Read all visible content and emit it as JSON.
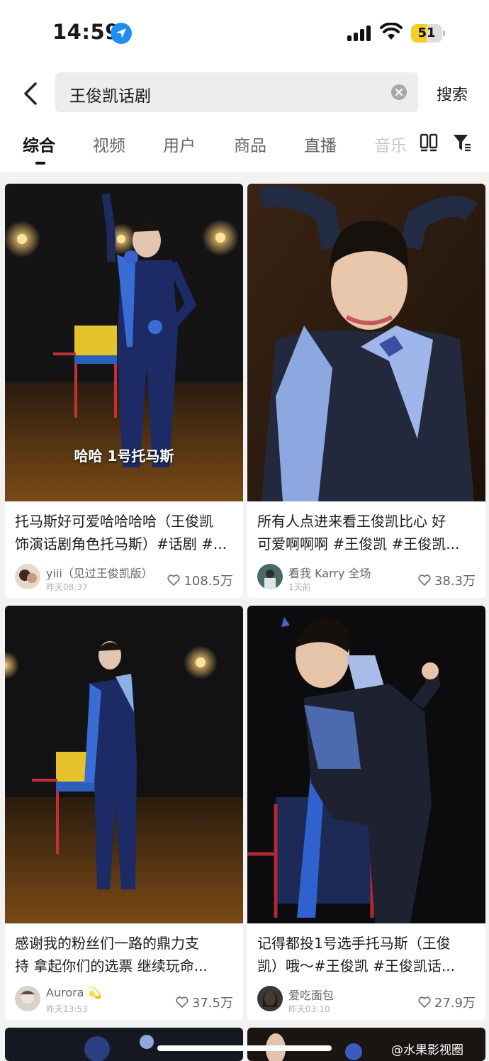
{
  "status": {
    "time": "14:59",
    "battery": "51",
    "battery_level": 0.51
  },
  "search": {
    "query": "王俊凯话剧",
    "button_label": "搜索"
  },
  "tabs": [
    {
      "label": "综合",
      "active": true
    },
    {
      "label": "视频"
    },
    {
      "label": "用户"
    },
    {
      "label": "商品"
    },
    {
      "label": "直播"
    },
    {
      "label": "音乐"
    }
  ],
  "results": [
    {
      "caption": "哈哈 1号托马斯",
      "title_line1": "托马斯好可爱哈哈哈哈（王俊凯",
      "title_line2": "饰演话剧角色托马斯）#话剧 #...",
      "author": "yiii（见过王俊凯版）",
      "time": "昨天08:37",
      "likes": "108.5万"
    },
    {
      "caption": "",
      "title_line1": "所有人点进来看王俊凯比心 好",
      "title_line2": "可爱啊啊啊 #王俊凯 #王俊凯...",
      "author": "看我 Karry 全场",
      "time": "1天前",
      "likes": "38.3万"
    },
    {
      "caption": "",
      "title_line1": "感谢我的粉丝们一路的鼎力支",
      "title_line2": "持 拿起你们的选票 继续玩命...",
      "author": "Aurora 💫",
      "time": "昨天13:53",
      "likes": "37.5万"
    },
    {
      "caption": "",
      "title_line1": "记得都投1号选手托马斯（王俊",
      "title_line2": "凯）哦～#王俊凯 #王俊凯话...",
      "author": "爱吃面包",
      "time": "昨天03:10",
      "likes": "27.9万"
    }
  ],
  "watermark": "@水果影视圈",
  "icons": {
    "location": "location-arrow-icon",
    "signal": "cellular-signal-icon",
    "wifi": "wifi-icon",
    "back": "chevron-left-icon",
    "clear": "clear-circle-icon",
    "layout": "two-column-layout-icon",
    "filter": "filter-funnel-icon",
    "like": "heart-outline-icon"
  },
  "colors": {
    "accent_blue": "#1f8ef1",
    "battery_yellow": "#f5cf25",
    "page_bg": "#f2f2f2"
  }
}
